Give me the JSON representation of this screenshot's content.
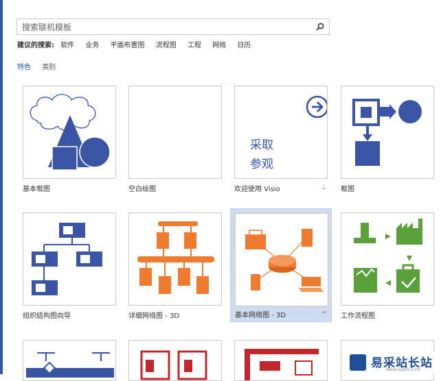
{
  "search": {
    "placeholder": "搜索联机模板"
  },
  "suggested": {
    "label": "建议的搜索:",
    "links": [
      "软件",
      "业务",
      "平面布置图",
      "流程图",
      "工程",
      "网络",
      "日历"
    ]
  },
  "tabs": [
    {
      "label": "特色",
      "active": true
    },
    {
      "label": "类别",
      "active": false
    }
  ],
  "templates": [
    {
      "title": "基本框图"
    },
    {
      "title": "空白绘图"
    },
    {
      "title": "欢迎使用 Visio",
      "thumb_text": [
        "采取",
        "参观"
      ],
      "pinnable": true
    },
    {
      "title": "框图"
    },
    {
      "title": "组织结构图向导"
    },
    {
      "title": "详细网络图 - 3D"
    },
    {
      "title": "基本网络图 - 3D",
      "selected": true,
      "pinnable": true
    },
    {
      "title": "工作流程图"
    }
  ],
  "colors": {
    "blue": "#3a55a3",
    "orange": "#ee7b30",
    "green": "#5aa13b",
    "red": "#c0282d",
    "selection": "#cfdbef"
  },
  "watermark": {
    "brand": "易采站长站",
    "url": "Www.Easck.Com"
  }
}
